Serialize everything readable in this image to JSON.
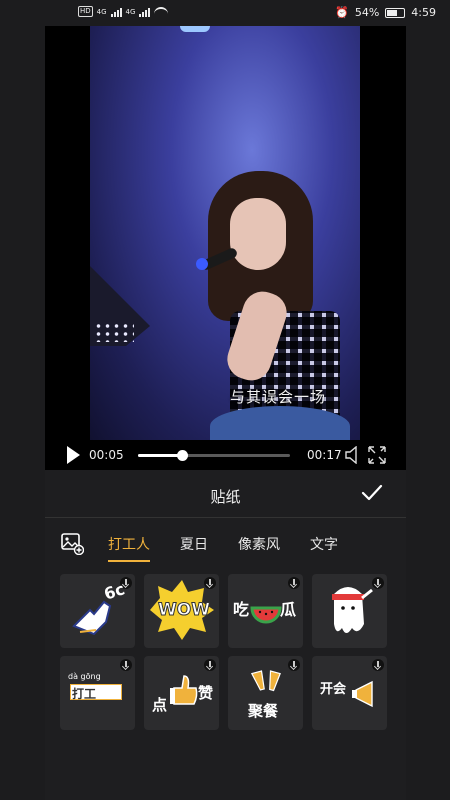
{
  "status_bar": {
    "network_badge": "HD",
    "network_1": "4G",
    "network_2": "4G",
    "battery_percent": "54%",
    "time": "4:59"
  },
  "video": {
    "subtitle": "与其误会一场"
  },
  "player": {
    "current_time": "00:05",
    "duration": "00:17",
    "progress_fraction": 0.29
  },
  "panel": {
    "title": "贴纸"
  },
  "tabs": [
    {
      "label": "打工人",
      "active": true
    },
    {
      "label": "夏日",
      "active": false
    },
    {
      "label": "像素风",
      "active": false
    },
    {
      "label": "文字",
      "active": false
    }
  ],
  "stickers": [
    {
      "name": "sticker-6c-hand",
      "text": "6c"
    },
    {
      "name": "sticker-wow",
      "text": "WOW"
    },
    {
      "name": "sticker-chi-gua",
      "text_a": "吃",
      "text_b": "瓜"
    },
    {
      "name": "sticker-ghost",
      "text": ""
    },
    {
      "name": "sticker-da-gong",
      "pinyin": "dà gōng",
      "text": "打工"
    },
    {
      "name": "sticker-dian-zan",
      "text_a": "点",
      "text_b": "赞"
    },
    {
      "name": "sticker-ju-can",
      "text": "聚餐"
    },
    {
      "name": "sticker-kai-hui",
      "text": "开会"
    }
  ],
  "colors": {
    "accent": "#f0b23c",
    "panel_bg": "#1e1e20",
    "card_bg": "#2c2c2e"
  }
}
